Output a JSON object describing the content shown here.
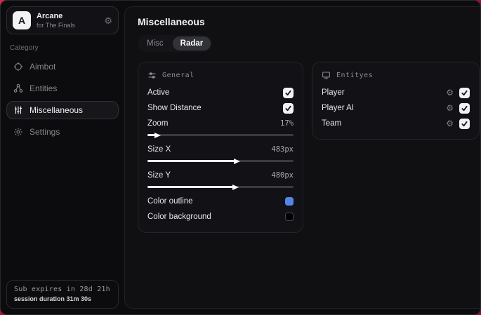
{
  "colors": {
    "accent_red": "#a8152f",
    "outline_swatch": "#5584e8",
    "background_swatch": "#000000"
  },
  "sidebar": {
    "app": {
      "logo_letter": "A",
      "name": "Arcane",
      "subtitle": "for The Finals",
      "gear_icon": "⚙"
    },
    "category_label": "Category",
    "items": [
      {
        "label": "Aimbot",
        "active": false
      },
      {
        "label": "Entities",
        "active": false
      },
      {
        "label": "Miscellaneous",
        "active": true
      },
      {
        "label": "Settings",
        "active": false
      }
    ],
    "subscription": {
      "line1": "Sub expires in 28d 21h",
      "line2": "session duration 31m 30s"
    }
  },
  "main": {
    "title": "Miscellaneous",
    "tabs": [
      {
        "label": "Misc",
        "active": false
      },
      {
        "label": "Radar",
        "active": true
      }
    ],
    "general": {
      "header": "General",
      "active": {
        "label": "Active",
        "checked": true
      },
      "show_distance": {
        "label": "Show Distance",
        "checked": true
      },
      "zoom": {
        "label": "Zoom",
        "value": "17%",
        "fill": "6%"
      },
      "size_x": {
        "label": "Size X",
        "value": "483px",
        "fill": "60%"
      },
      "size_y": {
        "label": "Size Y",
        "value": "480px",
        "fill": "59%"
      },
      "color_outline": {
        "label": "Color outline",
        "color": "#5584e8"
      },
      "color_background": {
        "label": "Color background",
        "color": "#000000"
      }
    },
    "entities": {
      "header": "Entityes",
      "rows": [
        {
          "label": "Player",
          "checked": true
        },
        {
          "label": "Player AI",
          "checked": true
        },
        {
          "label": "Team",
          "checked": true
        }
      ],
      "gear_icon": "⚙"
    }
  }
}
